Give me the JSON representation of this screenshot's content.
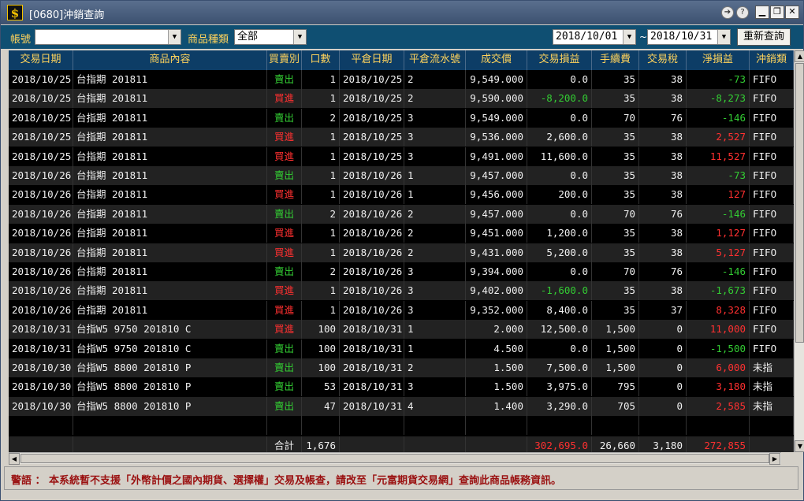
{
  "window": {
    "title": "[0680]沖銷查詢",
    "app_icon": "$"
  },
  "toolbar": {
    "account_label": "帳號",
    "account_value": "",
    "product_label": "商品種類",
    "product_value": "全部",
    "date_from": "2018/10/01",
    "date_sep": "~",
    "date_to": "2018/10/31",
    "query_button": "重新查詢"
  },
  "table": {
    "headers": [
      "交易日期",
      "商品內容",
      "買賣別",
      "口數",
      "平倉日期",
      "平倉流水號",
      "成交價",
      "交易損益",
      "手續費",
      "交易稅",
      "淨損益",
      "沖銷類"
    ],
    "rows": [
      [
        "2018/10/25",
        "台指期 201811",
        "賣出",
        "1",
        "2018/10/25",
        "2",
        "9,549.000",
        "0.0",
        "35",
        "38",
        "-73",
        "FIFO"
      ],
      [
        "2018/10/25",
        "台指期 201811",
        "買進",
        "1",
        "2018/10/25",
        "2",
        "9,590.000",
        "-8,200.0",
        "35",
        "38",
        "-8,273",
        "FIFO"
      ],
      [
        "2018/10/25",
        "台指期 201811",
        "賣出",
        "2",
        "2018/10/25",
        "3",
        "9,549.000",
        "0.0",
        "70",
        "76",
        "-146",
        "FIFO"
      ],
      [
        "2018/10/25",
        "台指期 201811",
        "買進",
        "1",
        "2018/10/25",
        "3",
        "9,536.000",
        "2,600.0",
        "35",
        "38",
        "2,527",
        "FIFO"
      ],
      [
        "2018/10/25",
        "台指期 201811",
        "買進",
        "1",
        "2018/10/25",
        "3",
        "9,491.000",
        "11,600.0",
        "35",
        "38",
        "11,527",
        "FIFO"
      ],
      [
        "2018/10/26",
        "台指期 201811",
        "賣出",
        "1",
        "2018/10/26",
        "1",
        "9,457.000",
        "0.0",
        "35",
        "38",
        "-73",
        "FIFO"
      ],
      [
        "2018/10/26",
        "台指期 201811",
        "買進",
        "1",
        "2018/10/26",
        "1",
        "9,456.000",
        "200.0",
        "35",
        "38",
        "127",
        "FIFO"
      ],
      [
        "2018/10/26",
        "台指期 201811",
        "賣出",
        "2",
        "2018/10/26",
        "2",
        "9,457.000",
        "0.0",
        "70",
        "76",
        "-146",
        "FIFO"
      ],
      [
        "2018/10/26",
        "台指期 201811",
        "買進",
        "1",
        "2018/10/26",
        "2",
        "9,451.000",
        "1,200.0",
        "35",
        "38",
        "1,127",
        "FIFO"
      ],
      [
        "2018/10/26",
        "台指期 201811",
        "買進",
        "1",
        "2018/10/26",
        "2",
        "9,431.000",
        "5,200.0",
        "35",
        "38",
        "5,127",
        "FIFO"
      ],
      [
        "2018/10/26",
        "台指期 201811",
        "賣出",
        "2",
        "2018/10/26",
        "3",
        "9,394.000",
        "0.0",
        "70",
        "76",
        "-146",
        "FIFO"
      ],
      [
        "2018/10/26",
        "台指期 201811",
        "買進",
        "1",
        "2018/10/26",
        "3",
        "9,402.000",
        "-1,600.0",
        "35",
        "38",
        "-1,673",
        "FIFO"
      ],
      [
        "2018/10/26",
        "台指期 201811",
        "買進",
        "1",
        "2018/10/26",
        "3",
        "9,352.000",
        "8,400.0",
        "35",
        "37",
        "8,328",
        "FIFO"
      ],
      [
        "2018/10/31",
        "台指W5 9750 201810 C",
        "買進",
        "100",
        "2018/10/31",
        "1",
        "2.000",
        "12,500.0",
        "1,500",
        "0",
        "11,000",
        "FIFO"
      ],
      [
        "2018/10/31",
        "台指W5 9750 201810 C",
        "賣出",
        "100",
        "2018/10/31",
        "1",
        "4.500",
        "0.0",
        "1,500",
        "0",
        "-1,500",
        "FIFO"
      ],
      [
        "2018/10/30",
        "台指W5 8800 201810 P",
        "賣出",
        "100",
        "2018/10/31",
        "2",
        "1.500",
        "7,500.0",
        "1,500",
        "0",
        "6,000",
        "未指"
      ],
      [
        "2018/10/30",
        "台指W5 8800 201810 P",
        "賣出",
        "53",
        "2018/10/31",
        "3",
        "1.500",
        "3,975.0",
        "795",
        "0",
        "3,180",
        "未指"
      ],
      [
        "2018/10/30",
        "台指W5 8800 201810 P",
        "賣出",
        "47",
        "2018/10/31",
        "4",
        "1.400",
        "3,290.0",
        "705",
        "0",
        "2,585",
        "未指"
      ]
    ],
    "total": {
      "label": "合計",
      "qty": "1,676",
      "trade_pnl": "302,695.0",
      "fee": "26,660",
      "tax": "3,180",
      "net_pnl": "272,855"
    }
  },
  "warning": "警語 ： 本系統暫不支援「外幣計價之國內期貨、選擇權」交易及帳查，請改至「元富期貨交易網」查詢此商品帳務資訊。",
  "colors": {
    "buy": "#ff3030",
    "sell": "#33cc33",
    "header_text": "#ffd35c",
    "toolbar_bg": "#0f4f72"
  }
}
